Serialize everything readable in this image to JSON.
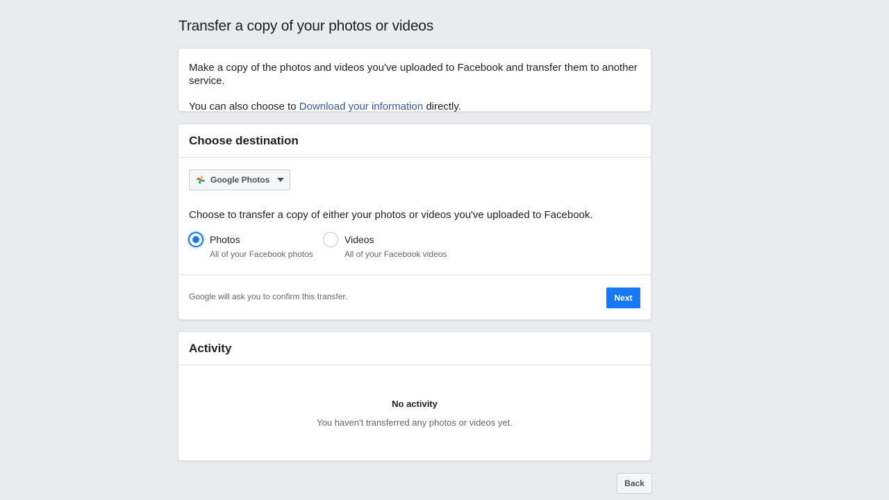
{
  "page": {
    "title": "Transfer a copy of your photos or videos"
  },
  "intro": {
    "line1": "Make a copy of the photos and videos you've uploaded to Facebook and transfer them to another service.",
    "line2_prefix": "You can also choose to ",
    "line2_link": "Download your information",
    "line2_suffix": " directly."
  },
  "destination": {
    "header": "Choose destination",
    "selected_service": "Google Photos",
    "service_icon": "google-photos-pinwheel-icon",
    "prompt": "Choose to transfer a copy of either your photos or videos you've uploaded to Facebook.",
    "options": [
      {
        "label": "Photos",
        "sub": "All of your Facebook photos",
        "checked": true
      },
      {
        "label": "Videos",
        "sub": "All of your Facebook videos",
        "checked": false
      }
    ],
    "footer_note": "Google will ask you to confirm this transfer.",
    "next_label": "Next"
  },
  "activity": {
    "header": "Activity",
    "empty_title": "No activity",
    "empty_sub": "You haven't transferred any photos or videos yet."
  },
  "back_label": "Back",
  "colors": {
    "accent": "#1877f2",
    "link": "#385898",
    "background": "#e9ebee"
  }
}
